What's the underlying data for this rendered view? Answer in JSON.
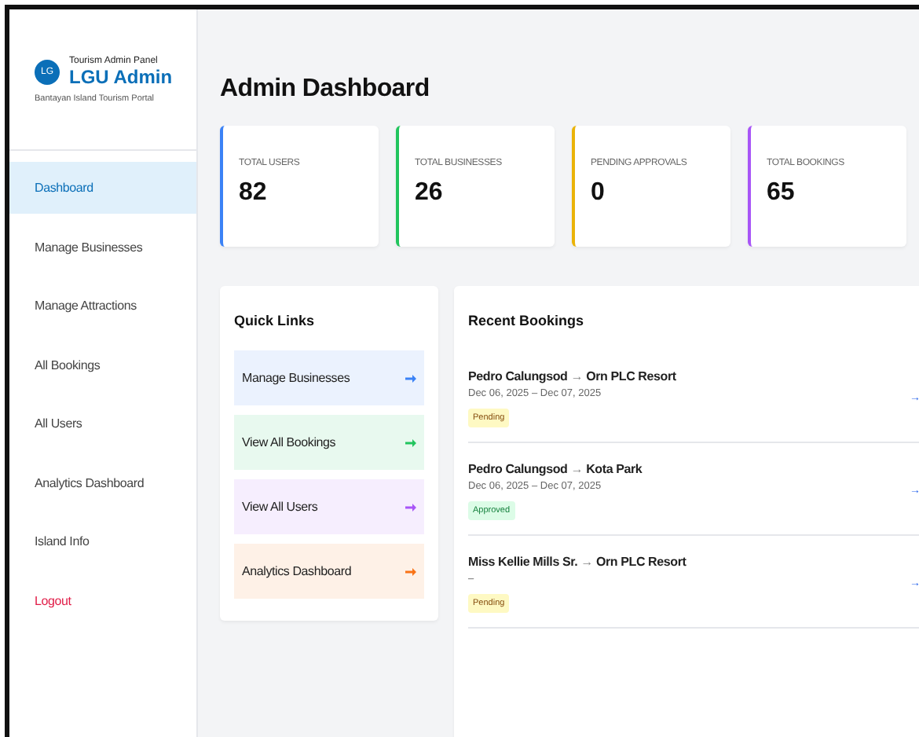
{
  "brand": {
    "logo": "LG",
    "panel": "Tourism Admin Panel",
    "title": "LGU Admin",
    "subtitle": "Bantayan Island Tourism Portal"
  },
  "sidebar": {
    "items": [
      {
        "label": "Dashboard",
        "selected": true,
        "kind": "link"
      },
      {
        "label": "Manage Businesses",
        "selected": false,
        "kind": "link"
      },
      {
        "label": "Manage Attractions",
        "selected": false,
        "kind": "link"
      },
      {
        "label": "All Bookings",
        "selected": false,
        "kind": "link"
      },
      {
        "label": "All Users",
        "selected": false,
        "kind": "link"
      },
      {
        "label": "Analytics Dashboard",
        "selected": false,
        "kind": "link"
      },
      {
        "label": "Island Info",
        "selected": false,
        "kind": "link"
      },
      {
        "label": "Logout",
        "selected": false,
        "kind": "danger"
      }
    ]
  },
  "page_title": "Admin Dashboard",
  "stats": [
    {
      "label": "TOTAL USERS",
      "value": "82",
      "color": "#3b82f6"
    },
    {
      "label": "TOTAL BUSINESSES",
      "value": "26",
      "color": "#22c55e"
    },
    {
      "label": "PENDING APPROVALS",
      "value": "0",
      "color": "#eab308"
    },
    {
      "label": "TOTAL BOOKINGS",
      "value": "65",
      "color": "#a855f7"
    }
  ],
  "quick_links": {
    "title": "Quick Links",
    "items": [
      {
        "label": "Manage Businesses",
        "color": "#3b82f6"
      },
      {
        "label": "View All Bookings",
        "color": "#22c55e"
      },
      {
        "label": "View All Users",
        "color": "#a855f7"
      },
      {
        "label": "Analytics Dashboard",
        "color": "#f97316"
      }
    ]
  },
  "recent_bookings": {
    "title": "Recent Bookings",
    "items": [
      {
        "guest": "Pedro Calungsod",
        "sep": "→",
        "place": "Orn PLC Resort",
        "dates": "Dec 06, 2025 – Dec 07, 2025",
        "status": "Pending",
        "kind": "pending",
        "arrow": "→"
      },
      {
        "guest": "Pedro Calungsod",
        "sep": "→",
        "place": "Kota Park",
        "dates": "Dec 06, 2025 – Dec 07, 2025",
        "status": "Approved",
        "kind": "approved",
        "arrow": "→"
      },
      {
        "guest": "Miss Kellie Mills Sr.",
        "sep": "→",
        "place": "Orn PLC Resort",
        "dates": "–",
        "status": "Pending",
        "kind": "pending",
        "arrow": "→"
      }
    ]
  }
}
